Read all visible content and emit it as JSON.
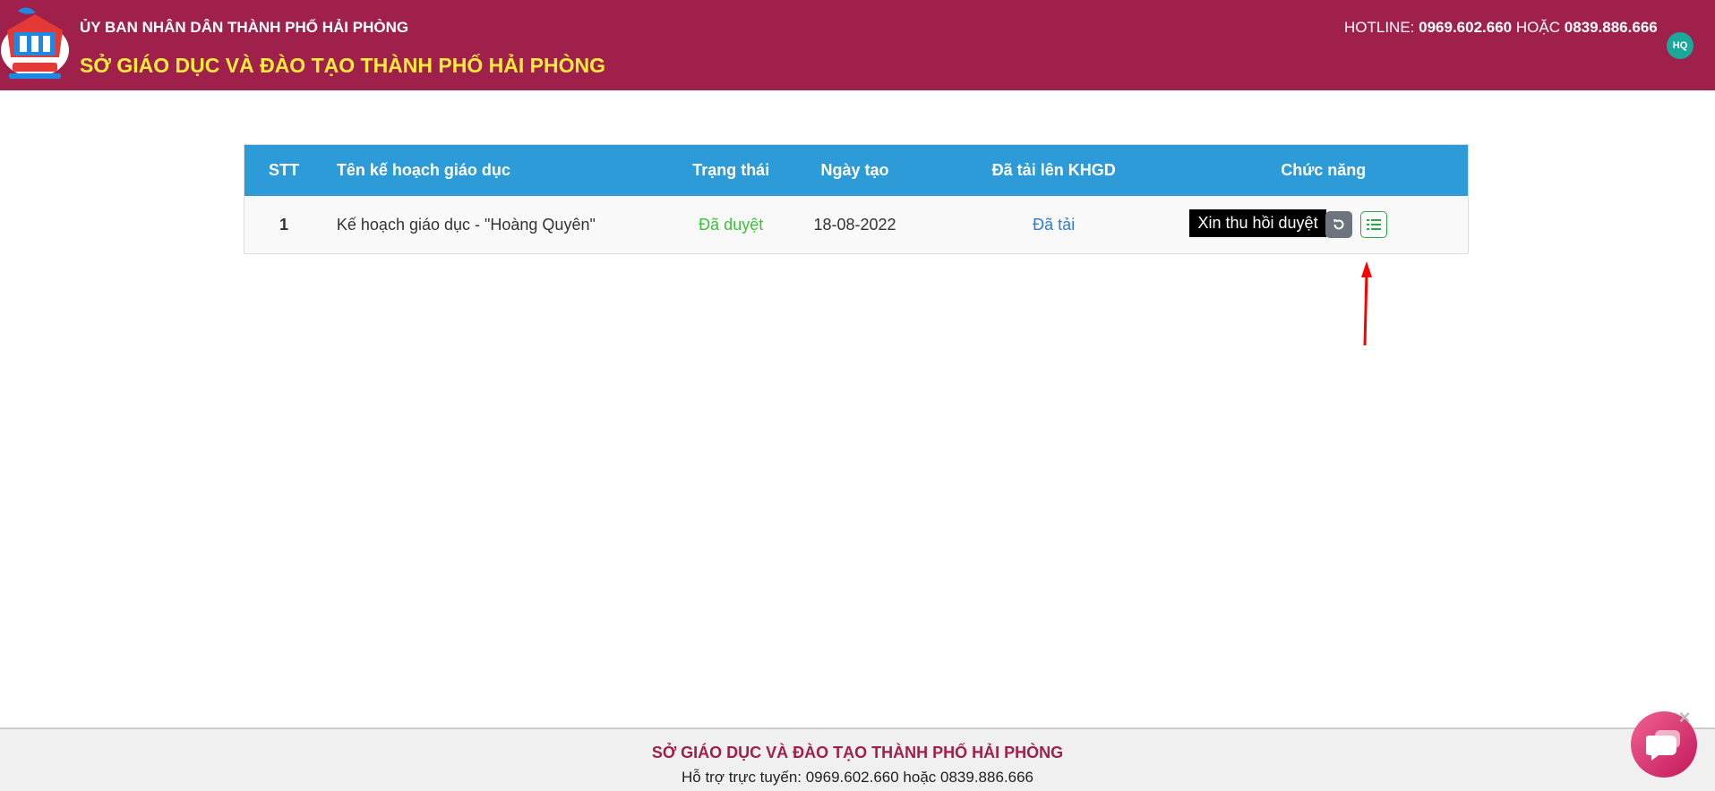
{
  "header": {
    "org_name": "ỦY BAN NHÂN DÂN THÀNH PHỐ HẢI PHÒNG",
    "dept_name": "SỞ GIÁO DỤC VÀ ĐÀO TẠO THÀNH PHỐ HẢI PHÒNG",
    "hotline_label": "HOTLINE:",
    "hotline_1": "0969.602.660",
    "hotline_or": "HOẶC",
    "hotline_2": "0839.886.666",
    "avatar_initials": "HQ",
    "bg_color": "#a0204c",
    "dept_color": "#ffeb3b"
  },
  "table": {
    "columns": [
      "STT",
      "Tên kế hoạch giáo dục",
      "Trạng thái",
      "Ngày tạo",
      "Đã tải lên KHGD",
      "Chức năng"
    ],
    "rows": [
      {
        "stt": "1",
        "name": "Kế hoạch giáo dục - \"Hoàng Quyên\"",
        "status": "Đã duyệt",
        "created": "18-08-2022",
        "uploaded": "Đã tải"
      }
    ],
    "header_color": "#2e9bd9"
  },
  "actions": {
    "tooltip": "Xin thu hồi duyệt",
    "revoke_icon": "undo-icon",
    "list_icon": "list-icon"
  },
  "footer": {
    "title": "SỞ GIÁO DỤC VÀ ĐÀO TẠO THÀNH PHỐ HẢI PHÒNG",
    "support": "Hỗ trợ trực tuyến: 0969.602.660 hoặc 0839.886.666"
  },
  "chat": {
    "icon": "chat-icon",
    "close_icon": "close-icon"
  }
}
